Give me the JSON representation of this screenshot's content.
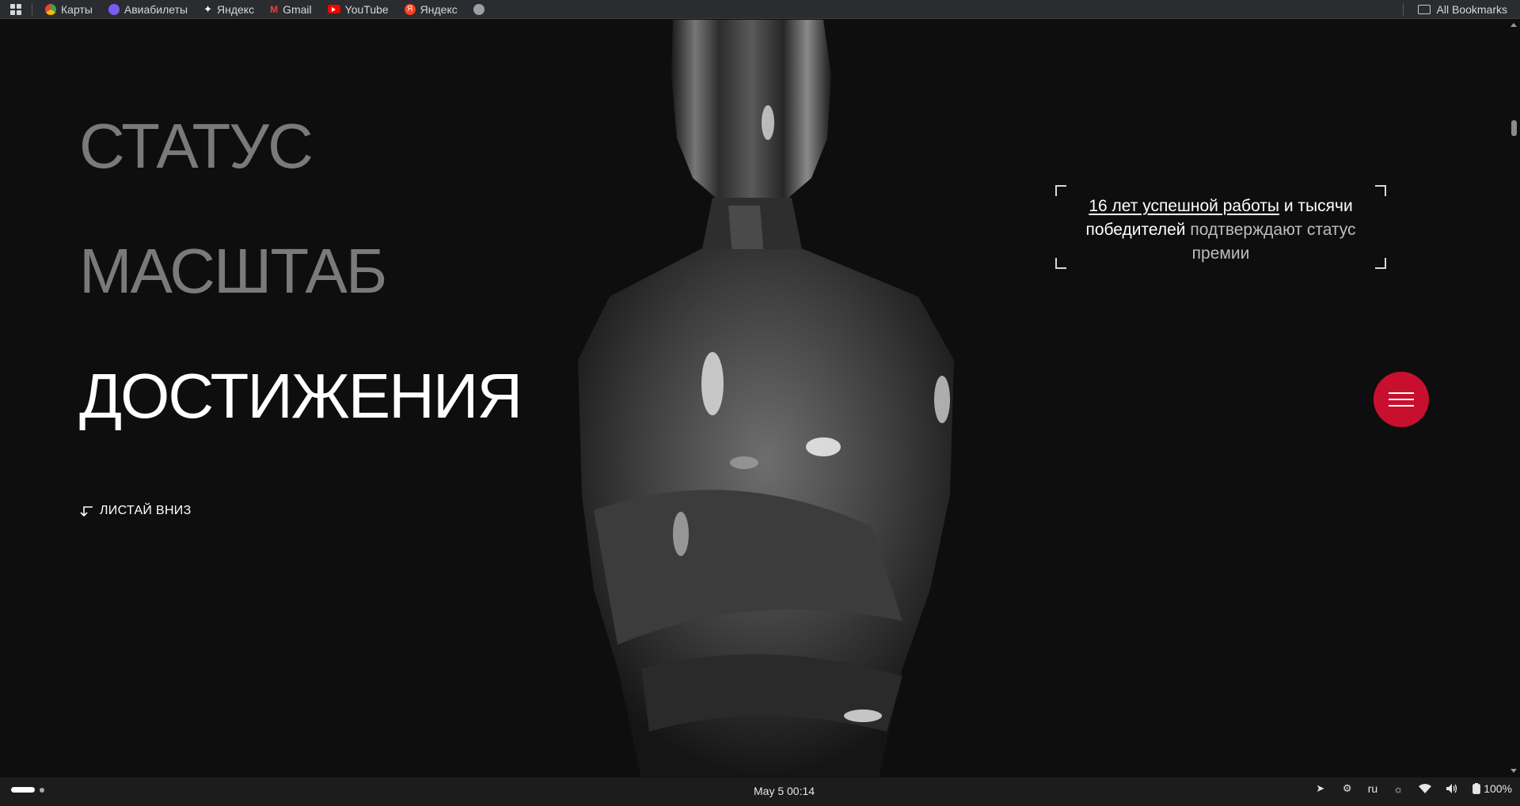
{
  "bookmarks_bar": {
    "items": [
      {
        "label": "Карты",
        "icon": "maps-pin-icon",
        "color": "#e44b3c"
      },
      {
        "label": "Авиабилеты",
        "icon": "aviasales-icon",
        "color": "#7a5cf0"
      },
      {
        "label": "Яндекс",
        "icon": "yandex-sparkle-icon",
        "color": "#ffffff"
      },
      {
        "label": "Gmail",
        "icon": "gmail-icon",
        "color": "#ea4335"
      },
      {
        "label": "YouTube",
        "icon": "youtube-icon",
        "color": "#ff0000"
      },
      {
        "label": "Яндекс",
        "icon": "yandex-icon",
        "color": "#fc3f1d"
      }
    ],
    "all_bookmarks": "All Bookmarks"
  },
  "hero": {
    "word1": "СТАТУС",
    "word2": "МАСШТАБ",
    "word3": "ДОСТИЖЕНИЯ",
    "scroll_hint": "ЛИСТАЙ ВНИЗ"
  },
  "caption": {
    "underlined": "16 лет успешной работы",
    "part2": " и тысячи ",
    "highlight": "победителей",
    "part3": " подтверждают статус премии"
  },
  "colors": {
    "background": "#0e0e0f",
    "accent": "#c8102e",
    "muted_text": "#7a7a7a"
  },
  "taskbar": {
    "clock": "May 5  00:14",
    "language": "ru",
    "battery": "100%"
  }
}
